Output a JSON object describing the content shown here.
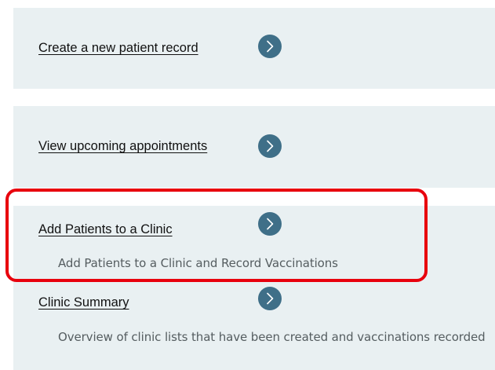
{
  "items": [
    {
      "label": "Create a new patient record",
      "description": ""
    },
    {
      "label": "View upcoming appointments",
      "description": ""
    },
    {
      "label": "Add Patients to a Clinic",
      "description": "Add Patients to a Clinic and Record Vaccinations"
    },
    {
      "label": "Clinic Summary",
      "description": "Overview of clinic lists that have been created and vaccinations recorded"
    }
  ],
  "icons": {
    "arrow": "chevron-right-icon"
  },
  "colors": {
    "card_background": "#e9f0f2",
    "arrow_button": "#3f6f88",
    "highlight_outline": "#e8000d"
  }
}
